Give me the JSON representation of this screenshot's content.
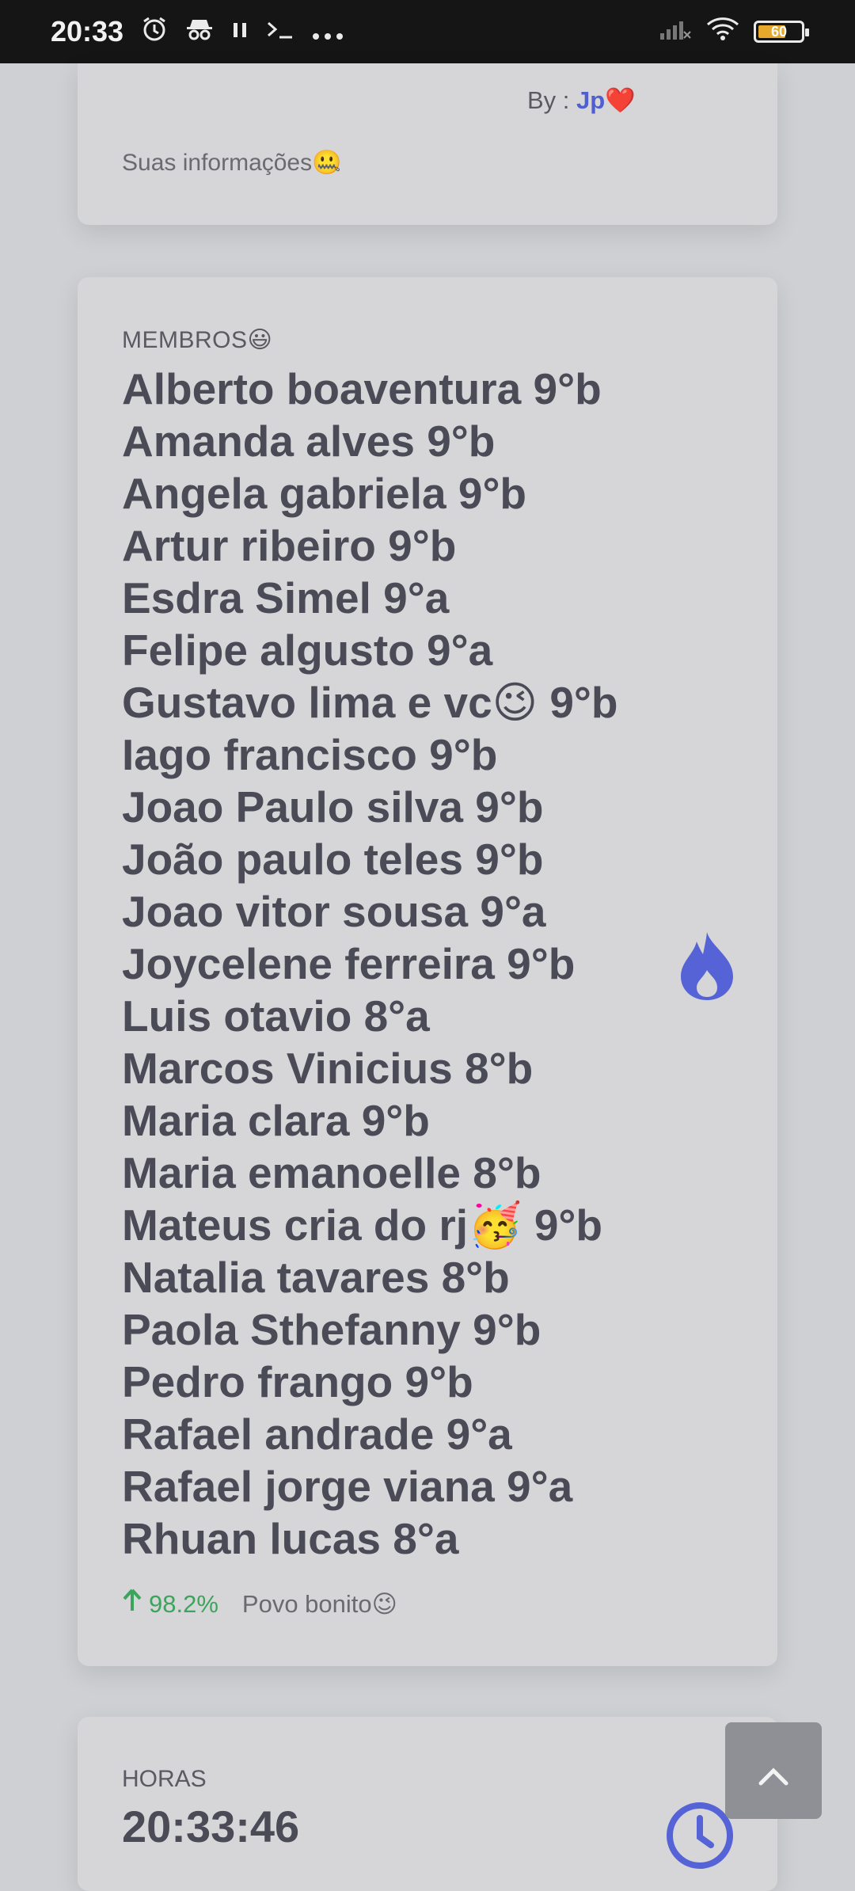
{
  "status_bar": {
    "time": "20:33",
    "icons": [
      "alarm-icon",
      "incognito-icon",
      "pause-icon",
      "terminal-icon",
      "more-icon"
    ],
    "battery_level": "60",
    "signal": "no-signal-icon",
    "wifi": "wifi-icon"
  },
  "top_card": {
    "by_label": "By : ",
    "author": "Jp",
    "heart": "❤️",
    "info_text": "Suas informações🤐"
  },
  "members_card": {
    "title": "MEMBROS😃",
    "members": [
      "Alberto boaventura 9°b",
      "Amanda alves 9°b",
      "Angela gabriela 9°b",
      "Artur ribeiro 9°b",
      "Esdra Simel 9°a",
      "Felipe algusto 9°a",
      "Gustavo lima e vc😉 9°b",
      "Iago francisco 9°b",
      "Joao Paulo silva 9°b",
      "João paulo teles 9°b",
      "Joao vitor sousa 9°a",
      "Joycelene ferreira 9°b",
      "Luis otavio 8°a",
      "Marcos Vinicius 8°b",
      "Maria clara 9°b",
      "Maria emanoelle 8°b",
      "Mateus cria do rj🥳 9°b",
      "Natalia tavares 8°b",
      "Paola Sthefanny 9°b",
      "Pedro frango 9°b",
      "Rafael andrade 9°a",
      "Rafael jorge viana 9°a",
      "Rhuan lucas 8°a"
    ],
    "stat_percent": "98.2%",
    "stat_note": "Povo bonito😉",
    "accent_color": "#5563d6",
    "positive_color": "#3aa55b"
  },
  "hours_card": {
    "title": "HORAS",
    "time": "20:33:46"
  },
  "scroll_top": {
    "icon": "chevron-up-icon"
  }
}
